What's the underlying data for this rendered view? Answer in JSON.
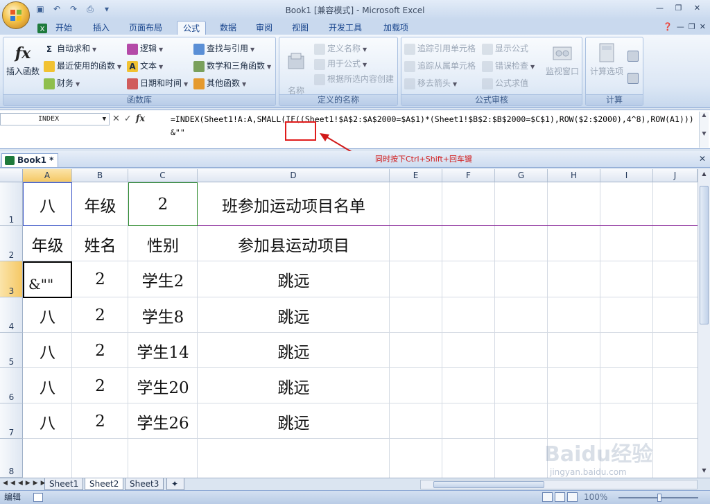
{
  "window": {
    "title": "Book1  [兼容模式] - Microsoft Excel"
  },
  "tabs": [
    "开始",
    "插入",
    "页面布局",
    "公式",
    "数据",
    "审阅",
    "视图",
    "开发工具",
    "加载项"
  ],
  "active_tab": "公式",
  "ribbon": {
    "function_library": {
      "label": "函数库",
      "insert_function": "插入函数",
      "autosum": "自动求和",
      "recent": "最近使用的函数",
      "financial": "财务",
      "logical": "逻辑",
      "text": "文本",
      "datetime": "日期和时间",
      "lookup": "查找与引用",
      "math": "数学和三角函数",
      "more": "其他函数"
    },
    "defined_names": {
      "label": "定义的名称",
      "name_manager": "名称\n管理器",
      "define_name": "定义名称",
      "use_in_formula": "用于公式",
      "create_from_selection": "根据所选内容创建"
    },
    "formula_auditing": {
      "label": "公式审核",
      "trace_precedents": "追踪引用单元格",
      "trace_dependents": "追踪从属单元格",
      "remove_arrows": "移去箭头",
      "show_formulas": "显示公式",
      "error_checking": "错误检查",
      "evaluate_formula": "公式求值",
      "watch_window": "监视窗口"
    },
    "calculation": {
      "label": "计算",
      "options": "计算选项"
    }
  },
  "formula_bar": {
    "name_box": "INDEX",
    "formula": "=INDEX(Sheet1!A:A,SMALL(IF((Sheet1!$A$2:$A$2000=$A$1)*(Sheet1!$B$2:$B$2000=$C$1),ROW($2:$2000),4^8),ROW(A1)))&\"\""
  },
  "annotation": "同时按下Ctrl+Shift+回车键",
  "workbook_tab": "Book1 *",
  "columns": [
    "A",
    "B",
    "C",
    "D",
    "E",
    "F",
    "G",
    "H",
    "I",
    "J"
  ],
  "rows": [
    "1",
    "2",
    "3",
    "4",
    "5",
    "6",
    "7",
    "8"
  ],
  "cells": {
    "r1": [
      "八",
      "年级",
      "2",
      "班参加运动项目名单"
    ],
    "r2": [
      "年级",
      "姓名",
      "性别",
      "参加县运动项目"
    ],
    "r3": [
      "&\"\"",
      "2",
      "学生2",
      "跳远"
    ],
    "r4": [
      "八",
      "2",
      "学生8",
      "跳远"
    ],
    "r5": [
      "八",
      "2",
      "学生14",
      "跳远"
    ],
    "r6": [
      "八",
      "2",
      "学生20",
      "跳远"
    ],
    "r7": [
      "八",
      "2",
      "学生26",
      "跳远"
    ]
  },
  "sheets": [
    "Sheet1",
    "Sheet2",
    "Sheet3"
  ],
  "active_sheet": "Sheet2",
  "status": {
    "mode": "编辑",
    "zoom": "100%"
  },
  "watermark": {
    "brand": "Baidu经验",
    "url": "jingyan.baidu.com"
  }
}
